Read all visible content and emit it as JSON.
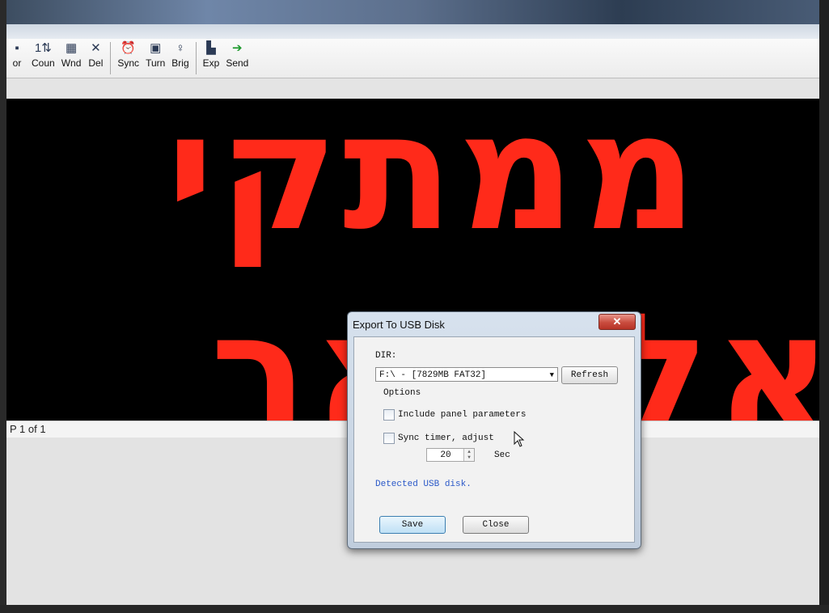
{
  "toolbar": {
    "items": [
      {
        "label": "or",
        "icon": "color-icon",
        "glyph": "▪"
      },
      {
        "label": "Coun",
        "icon": "counter-icon",
        "glyph": "1⇅"
      },
      {
        "label": "Wnd",
        "icon": "window-icon",
        "glyph": "▦"
      },
      {
        "label": "Del",
        "icon": "delete-icon",
        "glyph": "✕"
      },
      {
        "label": "Sync",
        "icon": "sync-icon",
        "glyph": "⏰"
      },
      {
        "label": "Turn",
        "icon": "turn-icon",
        "glyph": "▣"
      },
      {
        "label": "Brig",
        "icon": "brightness-icon",
        "glyph": "♀"
      },
      {
        "label": "Exp",
        "icon": "export-icon",
        "glyph": "▙"
      },
      {
        "label": "Send",
        "icon": "send-icon",
        "glyph": "➔"
      }
    ]
  },
  "display": {
    "line1": "ממתקי",
    "line2": "אל תאר",
    "text_color": "#ff2a1a",
    "background_color": "#000000"
  },
  "status_bar": {
    "page_indicator": "P 1 of 1"
  },
  "dialog": {
    "title": "Export To USB Disk",
    "close_glyph": "✕",
    "dir_label": "DIR:",
    "dir_value": "F:\\  - [7829MB FAT32]",
    "refresh_label": "Refresh",
    "options_label": "Options",
    "include_panel_label": "Include panel parameters",
    "include_panel_checked": false,
    "sync_timer_label": "Sync timer, adjust",
    "sync_timer_checked": false,
    "timer_value": "20",
    "sec_label": "Sec",
    "status_message": "Detected USB disk.",
    "save_label": "Save",
    "close_label": "Close"
  }
}
